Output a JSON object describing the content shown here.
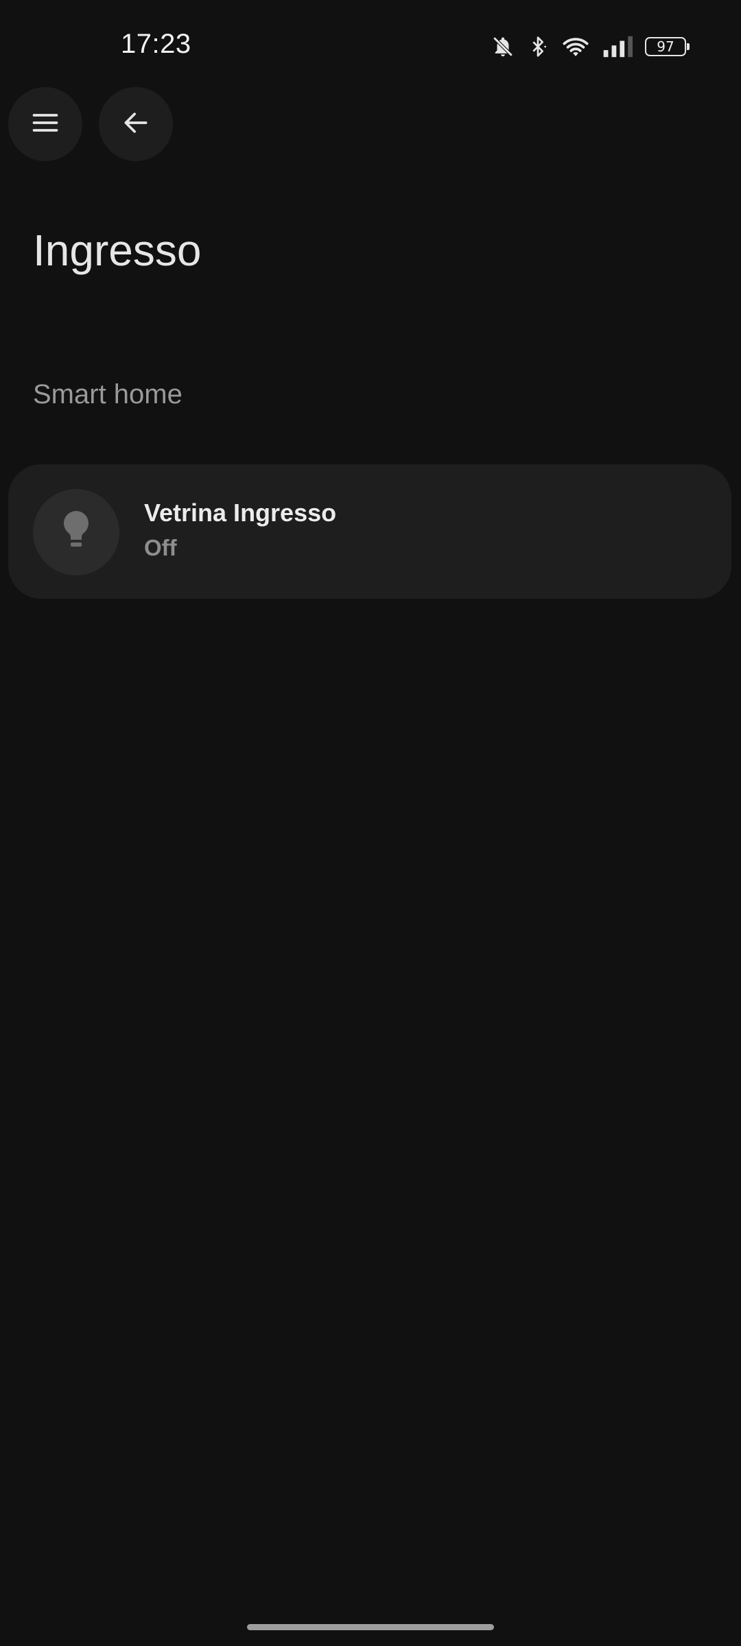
{
  "status_bar": {
    "time": "17:23",
    "battery_level": "97",
    "icons": [
      "bell-off-icon",
      "bluetooth-icon",
      "wifi-icon",
      "cellular-signal-icon",
      "battery-icon"
    ]
  },
  "nav": {
    "menu_icon": "menu-icon",
    "back_icon": "arrow-left-icon"
  },
  "page": {
    "title": "Ingresso",
    "section_title": "Smart home"
  },
  "devices": [
    {
      "name": "Vetrina Ingresso",
      "state": "Off",
      "icon": "lightbulb-icon"
    }
  ],
  "colors": {
    "background": "#111111",
    "card": "#1e1e1e",
    "icon_circle": "#2b2b2b",
    "icon_off": "#6e6e6e",
    "text_primary": "#ececec",
    "text_secondary": "#8e8e8e"
  }
}
